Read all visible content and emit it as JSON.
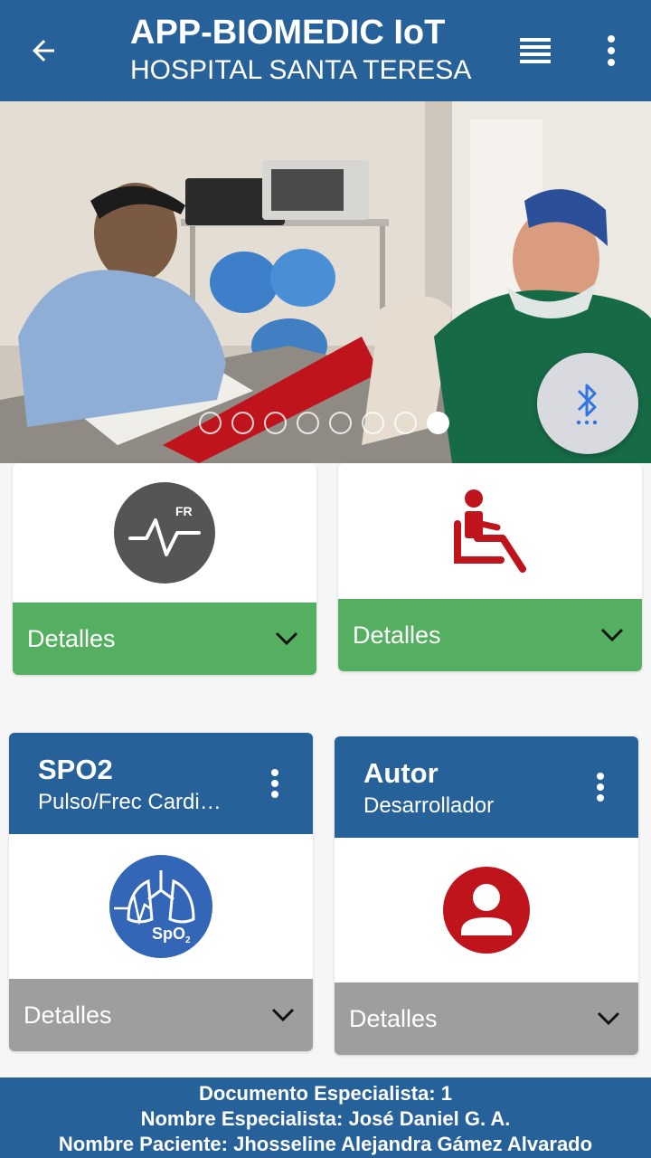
{
  "appbar": {
    "title": "APP-BIOMEDIC IoT",
    "subtitle": "HOSPITAL SANTA TERESA",
    "back_icon": "arrow-left-icon",
    "list_icon": "view-list-icon",
    "more_icon": "more-vert-icon"
  },
  "carousel": {
    "dot_count": 8,
    "active_index": 7,
    "fab_icon": "bluetooth-searching-icon"
  },
  "cards": {
    "fr": {
      "icon": "respiratory-rate-icon",
      "icon_text": "FR",
      "details_label": "Detalles"
    },
    "posture": {
      "icon": "seated-person-icon",
      "details_label": "Detalles"
    },
    "spo2": {
      "title": "SPO2",
      "subtitle": "Pulso/Frec Cardi…",
      "icon": "spo2-lungs-icon",
      "icon_text": "SpO",
      "icon_subscript": "2",
      "details_label": "Detalles"
    },
    "author": {
      "title": "Autor",
      "subtitle": "Desarrollador",
      "icon": "account-circle-icon",
      "details_label": "Detalles"
    }
  },
  "footer": {
    "line1": "Documento Especialista: 1",
    "line2": "Nombre Especialista: José Daniel G. A.",
    "line3": "Nombre Paciente: Jhosseline Alejandra Gámez Alvarado"
  },
  "colors": {
    "primary": "#27619a",
    "green": "#54b060",
    "gray": "#9e9e9e",
    "red": "#c0141c"
  }
}
